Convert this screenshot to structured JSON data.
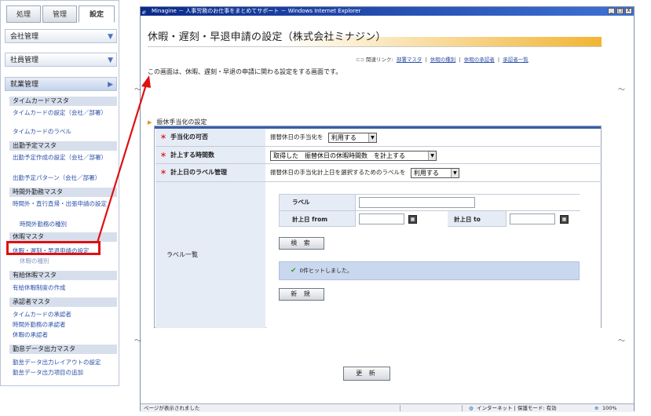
{
  "nav": {
    "tabs": [
      {
        "label": "処理"
      },
      {
        "label": "管理"
      },
      {
        "label": "設定"
      }
    ],
    "sections": {
      "company": "会社管理",
      "staff": "社員管理",
      "work": "就業管理"
    },
    "categories": {
      "timecard": "タイムカードマスタ",
      "attendance_plan": "出勤予定マスタ",
      "overtime": "時間外勤務マスタ",
      "leave": "休暇マスタ",
      "paid_leave": "有給休暇マスタ",
      "approver": "承認者マスタ",
      "export": "勤怠データ出力マスタ"
    },
    "links": {
      "timecard_settings": "タイムカードの設定（会社／部署）",
      "timecard_labels": "タイムカードのラベル",
      "plan_create": "出勤予定作成の設定（会社／部署）",
      "plan_pattern": "出勤予定パターン（会社／部署）",
      "overtime_request": "時間外・直行直帰・出張申請の設定",
      "overtime_types": "時間外勤務の種別",
      "leave_request": "休暇・遅刻・早退申請の設定",
      "leave_types": "休暇の種別",
      "paid_leave_rules": "有給休暇制度の作成",
      "timecard_approver": "タイムカードの承認者",
      "overtime_approver": "時間外勤務の承認者",
      "leave_approver": "休暇の承認者",
      "export_layout": "勤怠データ出力レイアウトの設定",
      "export_items": "勤怠データ出力項目の追加"
    }
  },
  "window": {
    "title": "Minagine － 人事労務のお仕事をまとめてサポート － Windows Internet Explorer",
    "buttons": {
      "min": "_",
      "max": "□",
      "close": "X"
    }
  },
  "page": {
    "title": "休暇・遅刻・早退申請の設定（株式会社ミナジン）",
    "related_label": "関連リンク:",
    "related_links": [
      "部署マスタ",
      "休暇の種別",
      "休暇の承認者",
      "承認者一覧"
    ],
    "related_sep": "|",
    "description": "この画面は、休暇、遅刻・早退の申請に関わる設定をする画面です。",
    "section_title": "振休手当化の設定"
  },
  "form": {
    "required_mark": "＊",
    "allowance_label": "手当化の可否",
    "allowance_text": "振替休日の手当化を",
    "allowance_value": "利用する",
    "hours_label": "計上する時間数",
    "hours_value": "取得した　振替休日の休暇時間数　を計上する",
    "date_label": "計上日のラベル管理",
    "date_text": "振替休日の手当化計上日を選択するためのラベルを",
    "date_value": "利用する",
    "label_list_label": "ラベル一覧",
    "search": {
      "label_field": "ラベル",
      "date_from": "計上日 from",
      "date_to": "計上日 to",
      "label_value": "",
      "from_value": "",
      "to_value": ""
    },
    "search_button": "検 索",
    "result_text": "0件ヒットしました。",
    "new_button": "新 規",
    "update_button": "更 新"
  },
  "statusbar": {
    "text": "ページが表示されました",
    "zone": "インターネット | 保護モード: 有効",
    "zoom": "100%"
  },
  "colors": {
    "highlight_red": "#e01010",
    "orange_accent": "#f1b534",
    "link_blue": "#2b4fa8"
  }
}
